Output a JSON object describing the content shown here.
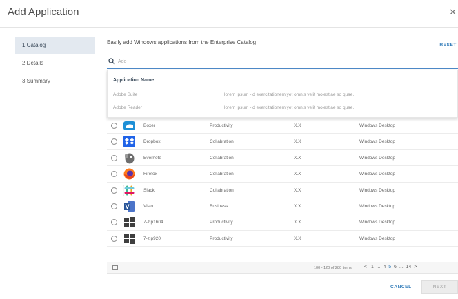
{
  "window": {
    "title": "Add Application",
    "close_glyph": "✕"
  },
  "steps": [
    {
      "label": "1  Catalog",
      "active": true
    },
    {
      "label": "2  Details",
      "active": false
    },
    {
      "label": "3  Summary",
      "active": false
    }
  ],
  "intro_text": "Easily add Windows applications from the Enterprise Catalog",
  "reset_label": "RESET",
  "search": {
    "value": "",
    "placeholder": "Ado",
    "icon": "search-icon"
  },
  "suggestions": {
    "header": "Application Name",
    "items": [
      {
        "name": "Adobe Suite",
        "description": "lorem ipsum - d exercitationem yet omnis velit molestiae so quae."
      },
      {
        "name": "Adobe Reader",
        "description": "lorem ipsum - d exercitationem yet omnis velit molestiae so quae."
      }
    ]
  },
  "apps": [
    {
      "name": "Boxer",
      "category": "Productivity",
      "version": "X.X",
      "platform": "Windows Desktop",
      "icon": "boxer-icon"
    },
    {
      "name": "Dropbox",
      "category": "Collabration",
      "version": "X.X",
      "platform": "Windows Desktop",
      "icon": "dropbox-icon"
    },
    {
      "name": "Evernote",
      "category": "Collabration",
      "version": "X.X",
      "platform": "Windows Desktop",
      "icon": "evernote-icon"
    },
    {
      "name": "Firefox",
      "category": "Collabration",
      "version": "X.X",
      "platform": "Windows Desktop",
      "icon": "firefox-icon"
    },
    {
      "name": "Slack",
      "category": "Collabration",
      "version": "X.X",
      "platform": "Windows Desktop",
      "icon": "slack-icon"
    },
    {
      "name": "Visio",
      "category": "Business",
      "version": "X.X",
      "platform": "Windows Desktop",
      "icon": "visio-icon"
    },
    {
      "name": "7-zip1604",
      "category": "Productivity",
      "version": "X.X",
      "platform": "Windows Desktop",
      "icon": "windows-icon"
    },
    {
      "name": "7-zip920",
      "category": "Productivity",
      "version": "X.X",
      "platform": "Windows Desktop",
      "icon": "windows-icon"
    }
  ],
  "pagination": {
    "summary": "100 - 120 of 280 items",
    "prev": "<",
    "pages_before": "1  ...  4",
    "current": "5",
    "pages_after": "6  ...  14",
    "next": ">"
  },
  "actions": {
    "cancel": "CANCEL",
    "next": "NEXT"
  },
  "colors": {
    "accent": "#2f7ab8",
    "active_step_bg": "#e3e9f0"
  }
}
